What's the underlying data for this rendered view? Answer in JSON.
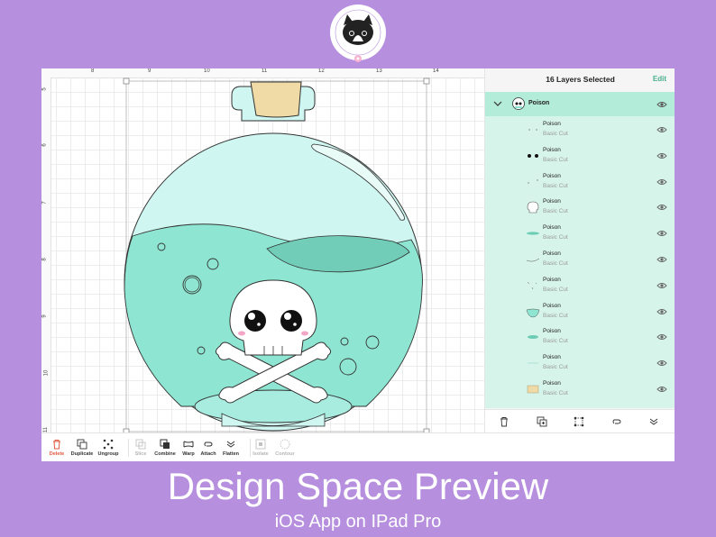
{
  "colors": {
    "band": "#b68fde",
    "accent": "#4ab08c",
    "group_bg": "#b3ecd9",
    "layer_bg": "#d7f4ea",
    "liquid": "#8ee6d2",
    "glass": "#cff6f0",
    "cork": "#f0dba7"
  },
  "logo": {
    "icon": "cat-face-logo",
    "text": "MOCHIKAWAIIDESIGNS"
  },
  "canvas": {
    "ruler_top": [
      "8",
      "9",
      "10",
      "11",
      "12",
      "13",
      "14"
    ],
    "ruler_left": [
      "5",
      "6",
      "7",
      "8",
      "9",
      "10",
      "11"
    ]
  },
  "panel": {
    "title": "16 Layers Selected",
    "edit_label": "Edit",
    "group": {
      "label": "Poison",
      "icon": "skull-group-icon"
    },
    "layers": [
      {
        "name": "Poison",
        "type": "Basic Cut",
        "thumb": "tiny-dots"
      },
      {
        "name": "Poison",
        "type": "Basic Cut",
        "thumb": "black-eyes"
      },
      {
        "name": "Poison",
        "type": "Basic Cut",
        "thumb": "small-dots"
      },
      {
        "name": "Poison",
        "type": "Basic Cut",
        "thumb": "skull-white"
      },
      {
        "name": "Poison",
        "type": "Basic Cut",
        "thumb": "green-ellipse"
      },
      {
        "name": "Poison",
        "type": "Basic Cut",
        "thumb": "thin-curve"
      },
      {
        "name": "Poison",
        "type": "Basic Cut",
        "thumb": "scatter-lines"
      },
      {
        "name": "Poison",
        "type": "Basic Cut",
        "thumb": "liquid-shape"
      },
      {
        "name": "Poison",
        "type": "Basic Cut",
        "thumb": "green-oval"
      },
      {
        "name": "Poison",
        "type": "Basic Cut",
        "thumb": "light-line"
      },
      {
        "name": "Poison",
        "type": "Basic Cut",
        "thumb": "cork-rect"
      }
    ],
    "footer_icons": [
      "trash-icon",
      "duplicate-icon",
      "group-icon",
      "attach-icon",
      "flatten-icon"
    ]
  },
  "toolbar": {
    "delete": "Delete",
    "duplicate": "Duplicate",
    "ungroup": "Ungroup",
    "slice": "Slice",
    "combine": "Combine",
    "warp": "Warp",
    "attach": "Attach",
    "flatten": "Flatten",
    "isolate": "Isolate",
    "contour": "Contour"
  },
  "caption": {
    "title": "Design Space Preview",
    "subtitle": "iOS App on IPad Pro"
  }
}
